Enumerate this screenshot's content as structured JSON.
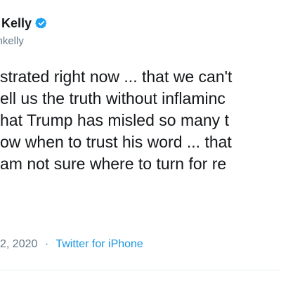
{
  "tweet": {
    "display_name": "n Kelly",
    "handle": "ynkelly",
    "text_lines": [
      "strated right now ... that we can't",
      "ell us the truth without inflaminc",
      "hat Trump has misled so many t",
      "ow when to trust his word ... that",
      "am not sure where to turn for re"
    ],
    "timestamp": "2, 2020",
    "separator": "·",
    "source": "Twitter for iPhone"
  },
  "icons": {
    "verified": "verified-badge-icon"
  },
  "colors": {
    "text_primary": "#14171a",
    "text_secondary": "#657786",
    "link": "#1b95e0",
    "verified_badge": "#1da1f2",
    "divider": "#e6ecf0"
  }
}
